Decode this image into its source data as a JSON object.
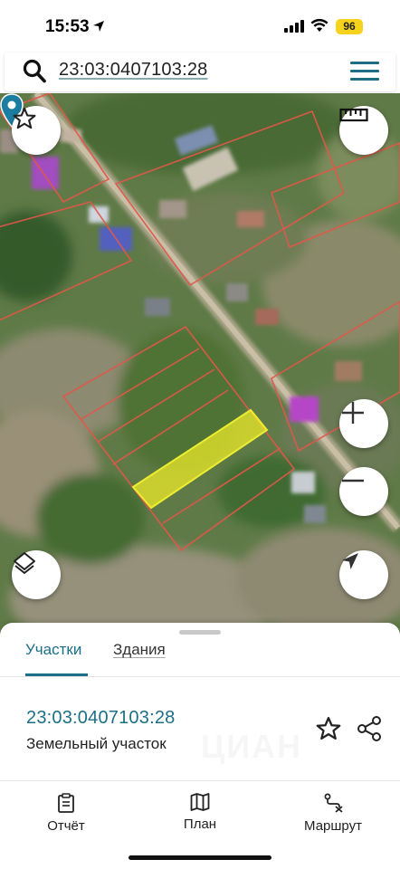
{
  "status": {
    "time": "15:53",
    "battery": "96"
  },
  "search": {
    "value": "23:03:0407103:28"
  },
  "icons": {
    "search": "search-icon",
    "menu": "menu-icon",
    "favorite": "star-icon",
    "ruler": "ruler-icon",
    "zoom_in": "plus-icon",
    "zoom_out": "minus-icon",
    "layers": "layers-icon",
    "locate": "navigation-arrow-icon",
    "pin": "map-pin-icon",
    "share": "share-icon"
  },
  "colors": {
    "accent": "#1b6f86",
    "parcel_outline": "#e0584a",
    "selected_parcel": "#e6e62a",
    "building_highlight": "#b548c8"
  },
  "sheet": {
    "tabs": [
      {
        "label": "Участки",
        "active": true
      },
      {
        "label": "Здания",
        "active": false
      }
    ],
    "parcel": {
      "number": "23:03:0407103:28",
      "type": "Земельный участок"
    },
    "watermark": "ЦИАН"
  },
  "bottom_nav": [
    {
      "label": "Отчёт",
      "icon": "report-icon"
    },
    {
      "label": "План",
      "icon": "map-book-icon"
    },
    {
      "label": "Маршрут",
      "icon": "route-icon"
    }
  ]
}
